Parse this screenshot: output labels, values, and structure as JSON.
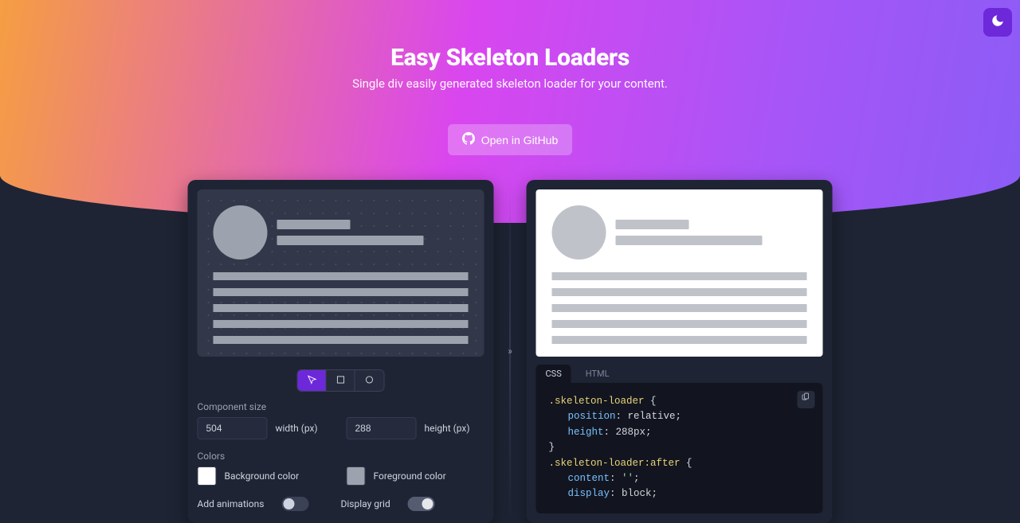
{
  "hero": {
    "title": "Easy Skeleton Loaders",
    "subtitle": "Single div easily generated skeleton loader for your content.",
    "github_label": "Open in GitHub"
  },
  "left": {
    "component_size_label": "Component size",
    "width_value": "504",
    "width_unit": "width (px)",
    "height_value": "288",
    "height_unit": "height (px)",
    "colors_label": "Colors",
    "bg_color": "#ffffff",
    "bg_label": "Background color",
    "fg_color": "#9ca3af",
    "fg_label": "Foreground color",
    "anim_label": "Add animations",
    "grid_label": "Display grid"
  },
  "right": {
    "tabs": {
      "css": "CSS",
      "html": "HTML"
    },
    "code": {
      "l1_sel": ".skeleton-loader",
      "l2_prop": "position",
      "l2_val": "relative",
      "l3_prop": "height",
      "l3_val": "288px",
      "l5_sel": ".skeleton-loader:after",
      "l6_prop": "content",
      "l6_val": "''",
      "l7_prop": "display",
      "l7_val": "block"
    }
  }
}
